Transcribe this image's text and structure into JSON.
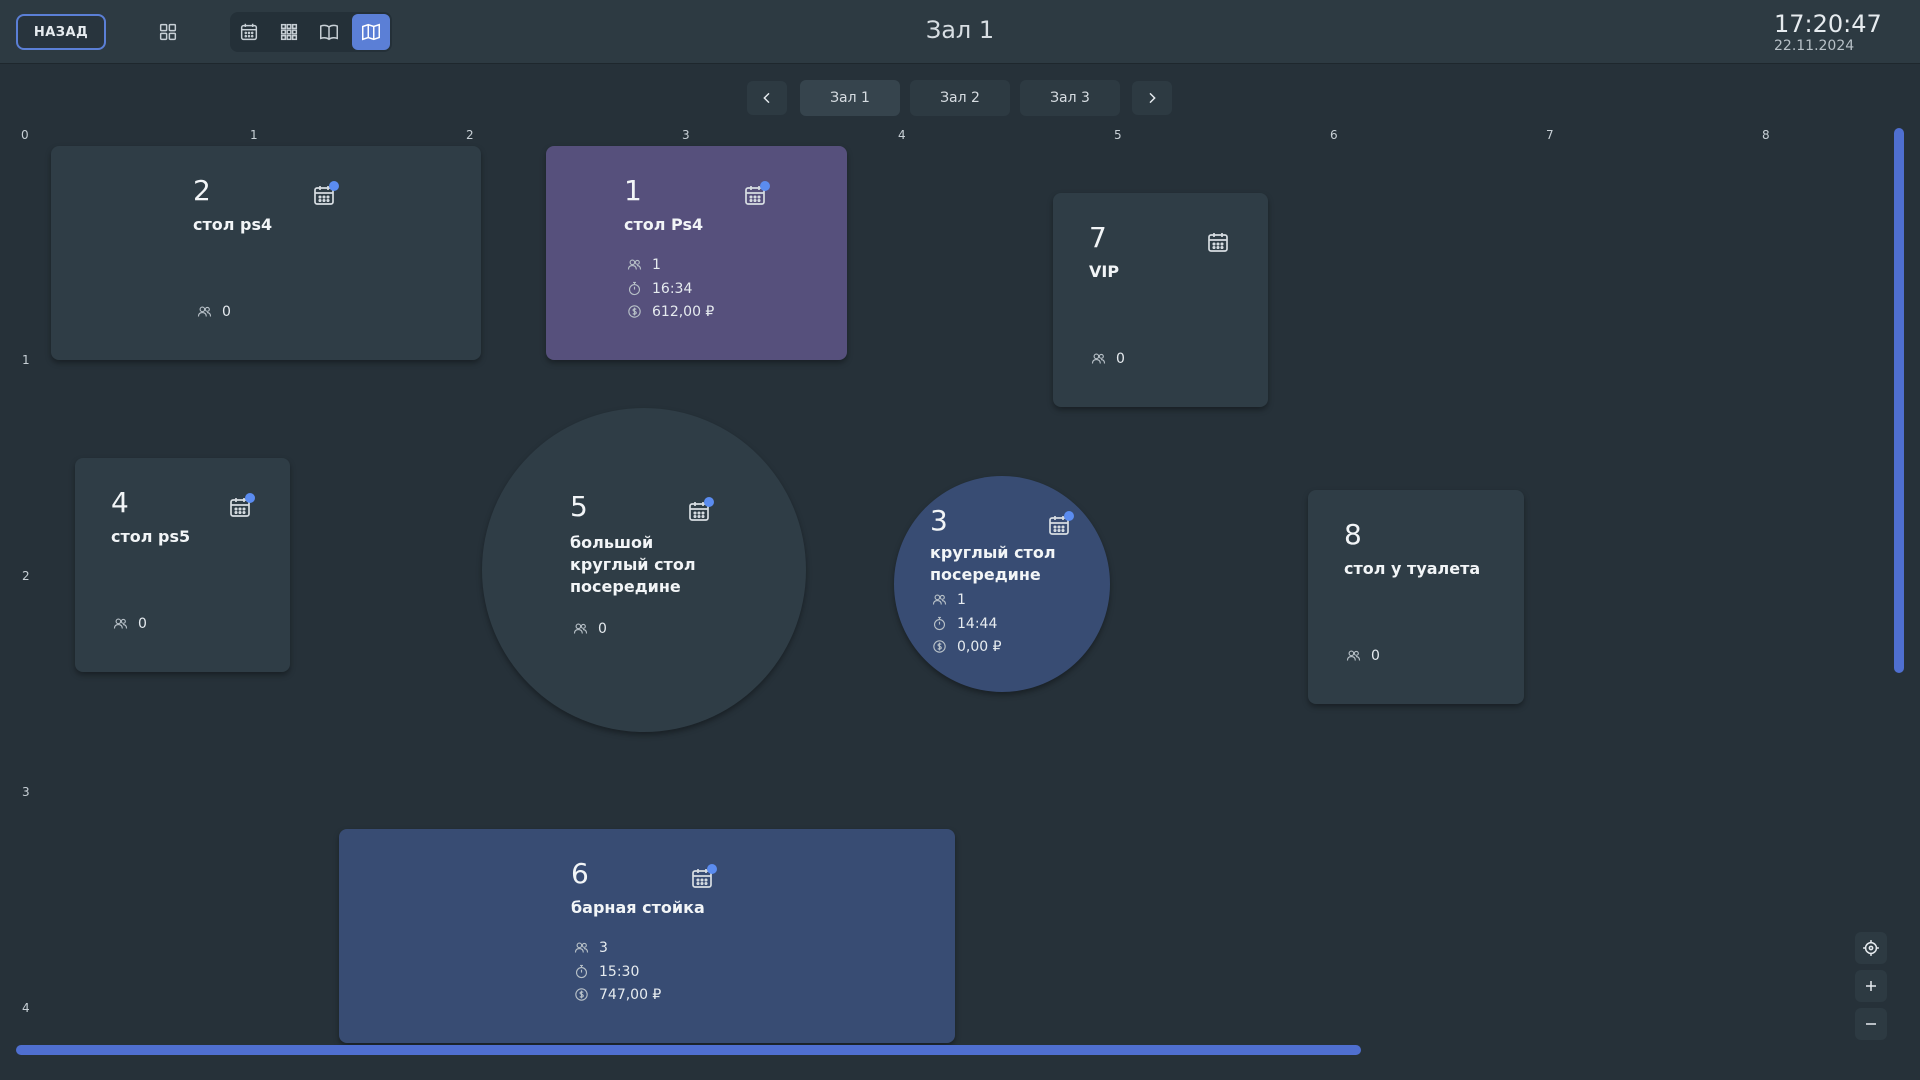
{
  "header": {
    "back_label": "НАЗАД",
    "title": "Зал 1",
    "time": "17:20:47",
    "date": "22.11.2024",
    "icons": [
      "grid-icon",
      "calendar-icon",
      "dots-grid-icon",
      "book-icon",
      "map-icon"
    ],
    "active_view": "map",
    "accent_color": "#5b7fd6"
  },
  "halls": {
    "tabs": [
      {
        "label": "Зал 1",
        "active": true
      },
      {
        "label": "Зал 2",
        "active": false
      },
      {
        "label": "Зал 3",
        "active": false
      }
    ]
  },
  "ruler": {
    "x": [
      "0",
      "1",
      "2",
      "3",
      "4",
      "5",
      "6",
      "7",
      "8"
    ],
    "y": [
      "1",
      "2",
      "3",
      "4"
    ]
  },
  "tables": {
    "t2": {
      "number": "2",
      "name": "стол ps4",
      "guests": "0",
      "has_booking": true
    },
    "t1": {
      "number": "1",
      "name": "стол Ps4",
      "guests": "1",
      "time": "16:34",
      "amount": "612,00 ₽",
      "has_booking": true,
      "status_color": "#56507c"
    },
    "t7": {
      "number": "7",
      "name": "VIP",
      "guests": "0",
      "has_booking": false
    },
    "t4": {
      "number": "4",
      "name": "стол ps5",
      "guests": "0",
      "has_booking": true
    },
    "t5": {
      "number": "5",
      "name_lines": [
        "большой",
        "круглый стол",
        "посередине"
      ],
      "guests": "0",
      "has_booking": true
    },
    "t3": {
      "number": "3",
      "name_lines": [
        "круглый стол",
        "посередине"
      ],
      "guests": "1",
      "time": "14:44",
      "amount": "0,00 ₽",
      "has_booking": true,
      "status_color": "#384c73"
    },
    "t8": {
      "number": "8",
      "name": "стол у туалета",
      "guests": "0"
    },
    "t6": {
      "number": "6",
      "name": "барная стойка",
      "guests": "3",
      "time": "15:30",
      "amount": "747,00 ₽",
      "has_booking": true,
      "status_color": "#384c73"
    }
  },
  "colors": {
    "background": "#263139",
    "table_default": "#2f3d46",
    "table_purple": "#56507c",
    "table_blue": "#384c73",
    "booking_dot": "#5b8cf0"
  }
}
